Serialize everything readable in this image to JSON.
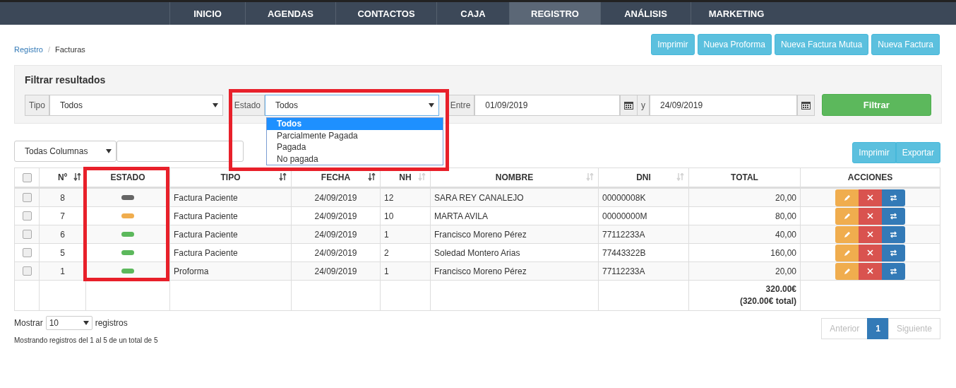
{
  "nav": [
    {
      "label": "INICIO",
      "selected": false
    },
    {
      "label": "AGENDAS",
      "selected": false
    },
    {
      "label": "CONTACTOS",
      "selected": false
    },
    {
      "label": "CAJA",
      "selected": false
    },
    {
      "label": "REGISTRO",
      "selected": true
    },
    {
      "label": "ANÁLISIS",
      "selected": false
    },
    {
      "label": "MARKETING",
      "selected": false
    }
  ],
  "breadcrumb": [
    {
      "label": "Registro",
      "kind": "link"
    },
    {
      "label": "/",
      "kind": "separator"
    },
    {
      "label": "Facturas",
      "kind": "current"
    }
  ],
  "top_buttons": [
    "Imprimir",
    "Nueva Proforma",
    "Nueva Factura Mutua",
    "Nueva Factura"
  ],
  "filter": {
    "title": "Filtrar resultados",
    "tipo_label": "Tipo",
    "tipo_value": "Todos",
    "estado_label": "Estado",
    "estado_value": "Todos",
    "estado_options": [
      {
        "label": "Todos",
        "selected": true
      },
      {
        "label": "Parcialmente Pagada",
        "selected": false
      },
      {
        "label": "Pagada",
        "selected": false
      },
      {
        "label": "No pagada",
        "selected": false
      }
    ],
    "entre_label": "Entre",
    "date_from": "01/09/2019",
    "y_label": "y",
    "date_to": "24/09/2019",
    "button": "Filtrar"
  },
  "column_select": "Todas Columnas",
  "table_buttons": [
    "Imprimir",
    "Exportar"
  ],
  "table": {
    "select_all_checked": false,
    "columns": [
      {
        "label": "Nº",
        "sortable": true,
        "sort_active": true
      },
      {
        "label": "ESTADO",
        "sortable": false
      },
      {
        "label": "TIPO",
        "sortable": true,
        "sort_active": true
      },
      {
        "label": "FECHA",
        "sortable": true,
        "sort_active": true
      },
      {
        "label": "NH",
        "sortable": true,
        "sort_active": false
      },
      {
        "label": "NOMBRE",
        "sortable": true,
        "sort_active": false
      },
      {
        "label": "DNI",
        "sortable": true,
        "sort_active": false
      },
      {
        "label": "TOTAL",
        "sortable": false
      },
      {
        "label": "ACCIONES",
        "sortable": false
      }
    ],
    "rows": [
      {
        "checked": false,
        "no": "8",
        "color": "#666666",
        "tipo": "Factura Paciente",
        "fecha": "24/09/2019",
        "nh": "12",
        "nombre": "SARA REY CANALEJO",
        "dni": "00000008K",
        "total": "20,00"
      },
      {
        "checked": false,
        "no": "7",
        "color": "#f0ad4e",
        "tipo": "Factura Paciente",
        "fecha": "24/09/2019",
        "nh": "10",
        "nombre": "MARTA AVILA",
        "dni": "00000000M",
        "total": "80,00"
      },
      {
        "checked": false,
        "no": "6",
        "color": "#5cb85c",
        "tipo": "Factura Paciente",
        "fecha": "24/09/2019",
        "nh": "1",
        "nombre": "Francisco Moreno Pérez",
        "dni": "77112233A",
        "total": "40,00"
      },
      {
        "checked": false,
        "no": "5",
        "color": "#5cb85c",
        "tipo": "Factura Paciente",
        "fecha": "24/09/2019",
        "nh": "2",
        "nombre": "Soledad Montero Arias",
        "dni": "77443322B",
        "total": "160,00"
      },
      {
        "checked": false,
        "no": "1",
        "color": "#5cb85c",
        "tipo": "Proforma",
        "fecha": "24/09/2019",
        "nh": "1",
        "nombre": "Francisco Moreno Pérez",
        "dni": "77112233A",
        "total": "20,00"
      }
    ],
    "footer_total": "320.00€",
    "footer_grand": "(320.00€ total)"
  },
  "length": {
    "before": "Mostrar",
    "value": "10",
    "after": "registros"
  },
  "info": "Mostrando registros del 1 al 5 de un total de 5",
  "pagination": [
    {
      "label": "Anterior",
      "selected": false,
      "disabled": true
    },
    {
      "label": "1",
      "selected": true,
      "disabled": false
    },
    {
      "label": "Siguiente",
      "selected": false,
      "disabled": true
    }
  ]
}
